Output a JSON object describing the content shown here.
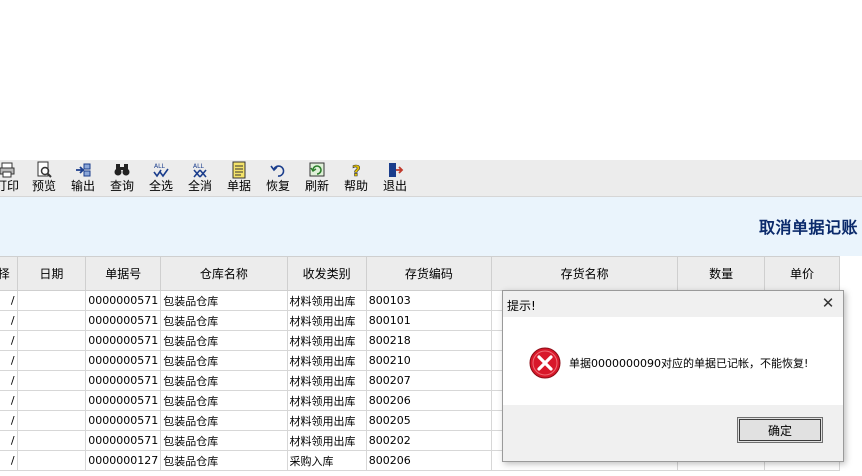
{
  "toolbar": {
    "buttons": [
      {
        "label": "打印",
        "icon": "printer-icon"
      },
      {
        "label": "预览",
        "icon": "preview-icon"
      },
      {
        "label": "输出",
        "icon": "export-icon"
      },
      {
        "label": "查询",
        "icon": "binoculars-icon"
      },
      {
        "label": "全选",
        "icon": "select-all-icon"
      },
      {
        "label": "全消",
        "icon": "deselect-all-icon"
      },
      {
        "label": "单据",
        "icon": "document-icon"
      },
      {
        "label": "恢复",
        "icon": "undo-icon"
      },
      {
        "label": "刷新",
        "icon": "refresh-icon"
      },
      {
        "label": "帮助",
        "icon": "help-icon"
      },
      {
        "label": "退出",
        "icon": "exit-icon"
      }
    ]
  },
  "banner": {
    "title": "取消单据记账"
  },
  "grid": {
    "columns": [
      "选择",
      "日期",
      "单据号",
      "仓库名称",
      "收发类别",
      "存货编码",
      "存货名称",
      "数量",
      "单价"
    ],
    "rows": [
      {
        "check": "/",
        "date": "",
        "doc_no": "0000000571",
        "warehouse": "包装品仓库",
        "category": "材料领用出库",
        "code": "800103",
        "name": "",
        "qty": "",
        "price": ""
      },
      {
        "check": "/",
        "date": "",
        "doc_no": "0000000571",
        "warehouse": "包装品仓库",
        "category": "材料领用出库",
        "code": "800101",
        "name": "",
        "qty": "",
        "price": ""
      },
      {
        "check": "/",
        "date": "",
        "doc_no": "0000000571",
        "warehouse": "包装品仓库",
        "category": "材料领用出库",
        "code": "800218",
        "name": "",
        "qty": "",
        "price": ""
      },
      {
        "check": "/",
        "date": "",
        "doc_no": "0000000571",
        "warehouse": "包装品仓库",
        "category": "材料领用出库",
        "code": "800210",
        "name": "",
        "qty": "",
        "price": ""
      },
      {
        "check": "/",
        "date": "",
        "doc_no": "0000000571",
        "warehouse": "包装品仓库",
        "category": "材料领用出库",
        "code": "800207",
        "name": "",
        "qty": "",
        "price": ""
      },
      {
        "check": "/",
        "date": "",
        "doc_no": "0000000571",
        "warehouse": "包装品仓库",
        "category": "材料领用出库",
        "code": "800206",
        "name": "",
        "qty": "",
        "price": ""
      },
      {
        "check": "/",
        "date": "",
        "doc_no": "0000000571",
        "warehouse": "包装品仓库",
        "category": "材料领用出库",
        "code": "800205",
        "name": "",
        "qty": "",
        "price": ""
      },
      {
        "check": "/",
        "date": "",
        "doc_no": "0000000571",
        "warehouse": "包装品仓库",
        "category": "材料领用出库",
        "code": "800202",
        "name": "",
        "qty": "",
        "price": ""
      },
      {
        "check": "/",
        "date": "",
        "doc_no": "0000000127",
        "warehouse": "包装品仓库",
        "category": "采购入库",
        "code": "800206",
        "name": "",
        "qty": "",
        "price": ""
      }
    ]
  },
  "dialog": {
    "title": "提示!",
    "close_icon": "close-icon",
    "message": "单据0000000090对应的单据已记帐，不能恢复!",
    "ok_label": "确定",
    "icon": "error-icon"
  },
  "colors": {
    "banner_bg": "#eaf4fc",
    "banner_title": "#0b2a6b",
    "error_red": "#d8182a"
  }
}
